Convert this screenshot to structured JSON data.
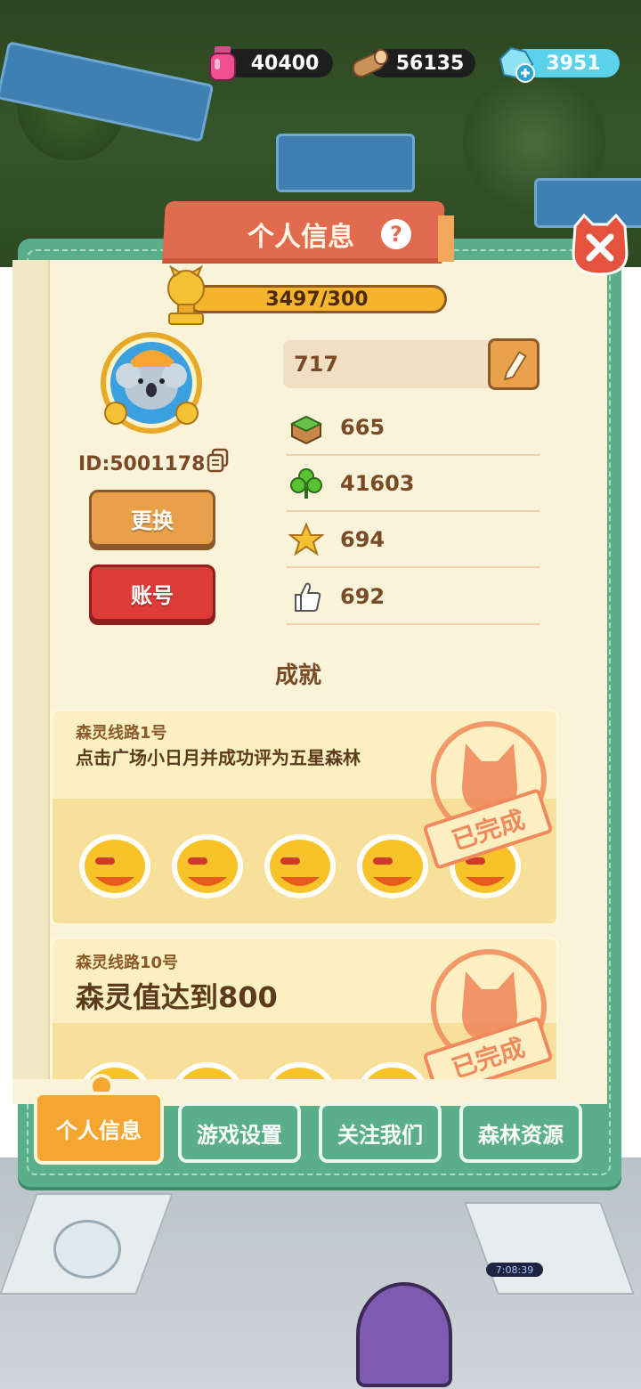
{
  "resources": {
    "potion": {
      "icon": "potion-bottle-icon",
      "value": "40400"
    },
    "wood": {
      "icon": "wood-log-icon",
      "value": "56135"
    },
    "gem": {
      "icon": "crystal-plus-icon",
      "value": "3951"
    }
  },
  "panel": {
    "title": "个人信息",
    "close_icon": "close-icon",
    "help_icon": "?"
  },
  "profile": {
    "xp": "3497/300",
    "id": "ID:5001178",
    "change_button": "更换",
    "account_button": "账号",
    "name": "717",
    "stats": [
      {
        "icon": "grass-block-icon",
        "value": "665"
      },
      {
        "icon": "clover-icon",
        "value": "41603"
      },
      {
        "icon": "star-icon",
        "value": "694"
      },
      {
        "icon": "thumbs-up-icon",
        "value": "692"
      }
    ]
  },
  "achievements": {
    "heading": "成就",
    "items": [
      {
        "subtitle": "森灵线路1号",
        "description": "点击广场小日月并成功评为五星森林",
        "status": "已完成"
      },
      {
        "subtitle": "森灵线路10号",
        "description": "森灵值达到800",
        "status": "已完成"
      }
    ]
  },
  "tabs": [
    {
      "label": "个人信息",
      "active": true
    },
    {
      "label": "游戏设置",
      "active": false
    },
    {
      "label": "关注我们",
      "active": false
    },
    {
      "label": "森林资源",
      "active": false
    }
  ],
  "scene": {
    "timer": "7:08:39"
  },
  "colors": {
    "panel_green": "#5aae8a",
    "title_orange": "#e26b4f",
    "paper": "#fbf3d9",
    "active_tab": "#f5a531",
    "account_red": "#dd3b38"
  }
}
